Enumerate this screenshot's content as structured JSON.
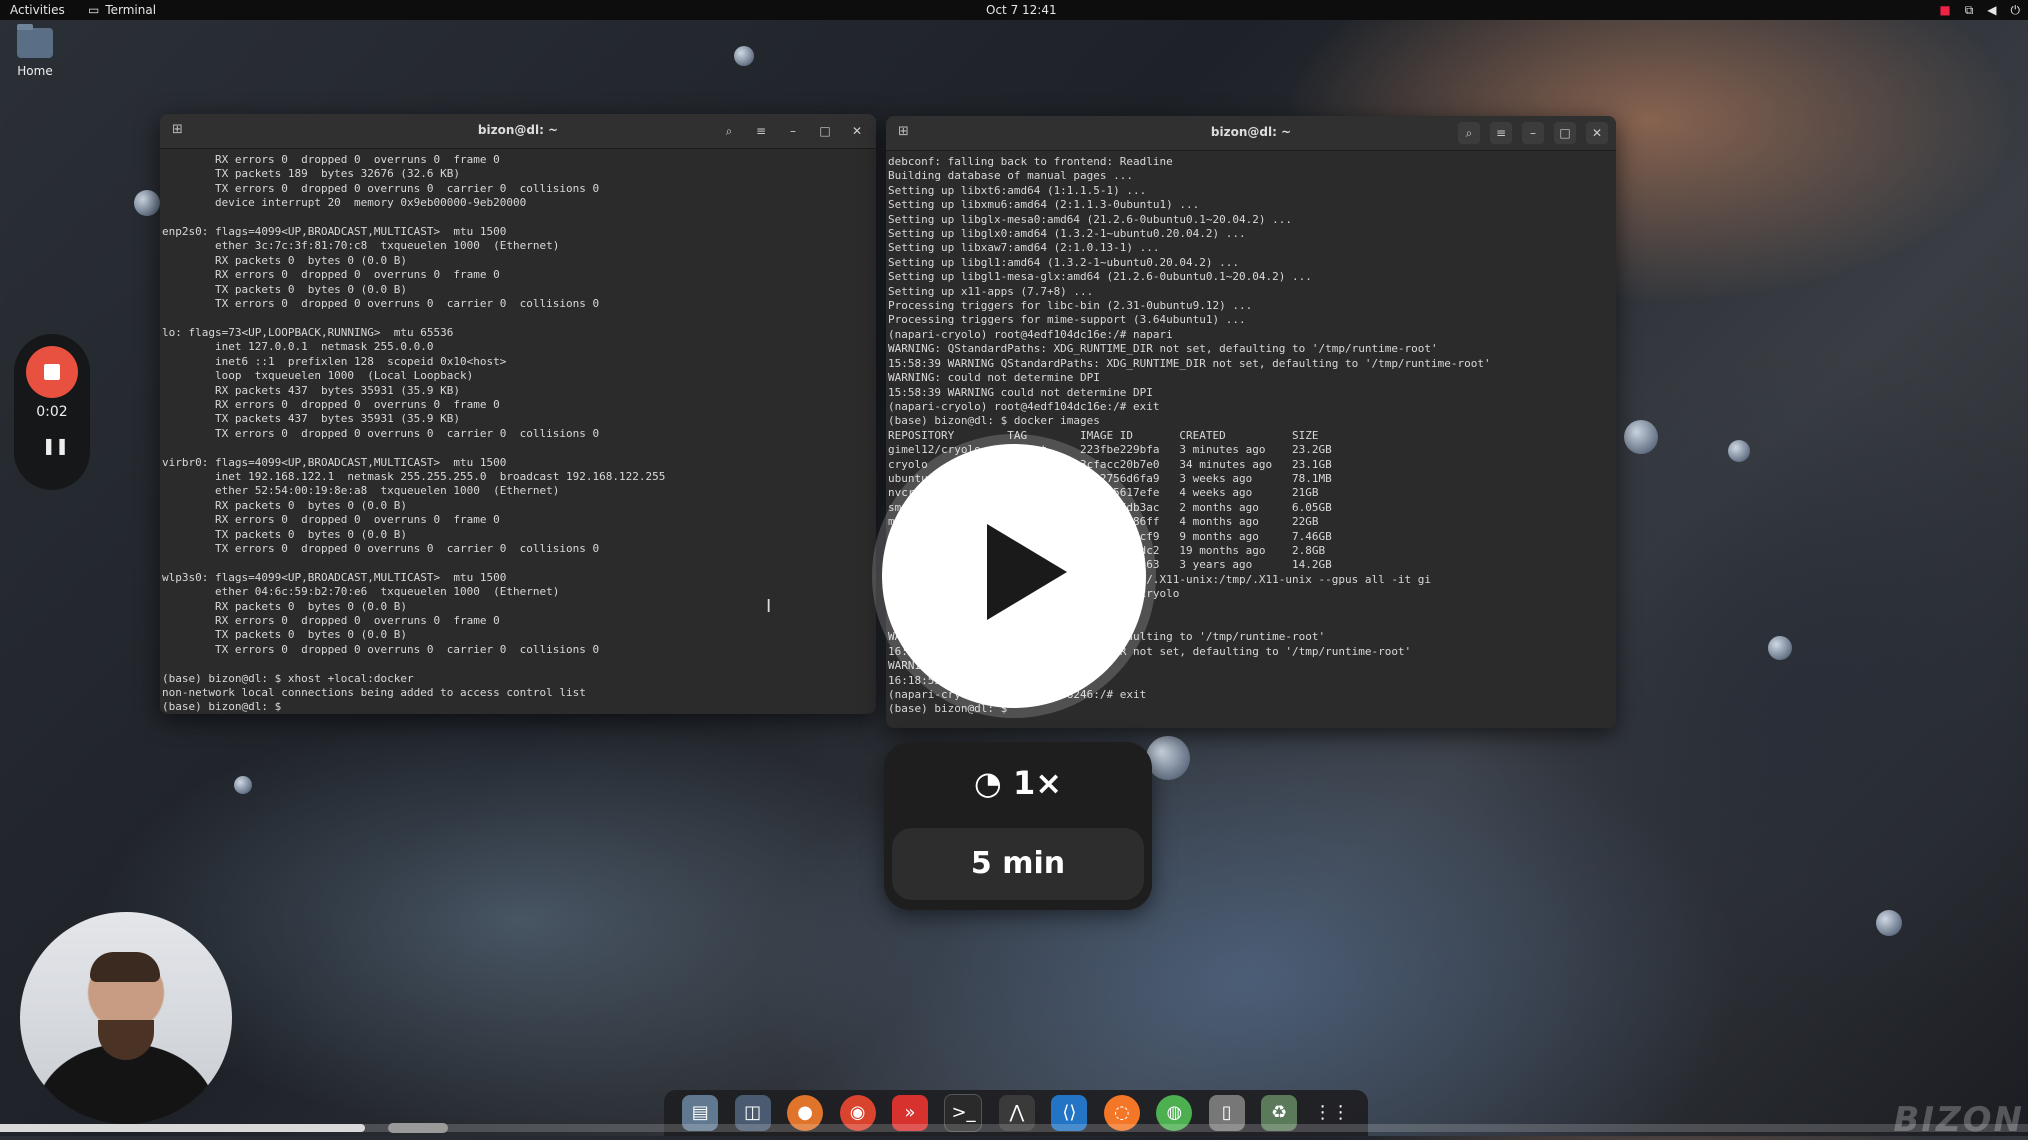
{
  "topbar": {
    "activities": "Activities",
    "app_name": "Terminal",
    "clock": "Oct 7  12:41"
  },
  "desktop": {
    "home_label": "Home"
  },
  "recorder": {
    "time": "0:02"
  },
  "terminal_left": {
    "title": "bizon@dl: ~",
    "lines": [
      "        RX errors 0  dropped 0  overruns 0  frame 0",
      "        TX packets 189  bytes 32676 (32.6 KB)",
      "        TX errors 0  dropped 0 overruns 0  carrier 0  collisions 0",
      "        device interrupt 20  memory 0x9eb00000-9eb20000",
      "",
      "enp2s0: flags=4099<UP,BROADCAST,MULTICAST>  mtu 1500",
      "        ether 3c:7c:3f:81:70:c8  txqueuelen 1000  (Ethernet)",
      "        RX packets 0  bytes 0 (0.0 B)",
      "        RX errors 0  dropped 0  overruns 0  frame 0",
      "        TX packets 0  bytes 0 (0.0 B)",
      "        TX errors 0  dropped 0 overruns 0  carrier 0  collisions 0",
      "",
      "lo: flags=73<UP,LOOPBACK,RUNNING>  mtu 65536",
      "        inet 127.0.0.1  netmask 255.0.0.0",
      "        inet6 ::1  prefixlen 128  scopeid 0x10<host>",
      "        loop  txqueuelen 1000  (Local Loopback)",
      "        RX packets 437  bytes 35931 (35.9 KB)",
      "        RX errors 0  dropped 0  overruns 0  frame 0",
      "        TX packets 437  bytes 35931 (35.9 KB)",
      "        TX errors 0  dropped 0 overruns 0  carrier 0  collisions 0",
      "",
      "virbr0: flags=4099<UP,BROADCAST,MULTICAST>  mtu 1500",
      "        inet 192.168.122.1  netmask 255.255.255.0  broadcast 192.168.122.255",
      "        ether 52:54:00:19:8e:a8  txqueuelen 1000  (Ethernet)",
      "        RX packets 0  bytes 0 (0.0 B)",
      "        RX errors 0  dropped 0  overruns 0  frame 0",
      "        TX packets 0  bytes 0 (0.0 B)",
      "        TX errors 0  dropped 0 overruns 0  carrier 0  collisions 0",
      "",
      "wlp3s0: flags=4099<UP,BROADCAST,MULTICAST>  mtu 1500",
      "        ether 04:6c:59:b2:70:e6  txqueuelen 1000  (Ethernet)",
      "        RX packets 0  bytes 0 (0.0 B)",
      "        RX errors 0  dropped 0  overruns 0  frame 0",
      "        TX packets 0  bytes 0 (0.0 B)",
      "        TX errors 0  dropped 0 overruns 0  carrier 0  collisions 0",
      "",
      "(base) bizon@dl: $ xhost +local:docker",
      "non-network local connections being added to access control list",
      "(base) bizon@dl: $ "
    ]
  },
  "terminal_right": {
    "title": "bizon@dl: ~",
    "lines": [
      "debconf: falling back to frontend: Readline",
      "Building database of manual pages ...",
      "Setting up libxt6:amd64 (1:1.1.5-1) ...",
      "Setting up libxmu6:amd64 (2:1.1.3-0ubuntu1) ...",
      "Setting up libglx-mesa0:amd64 (21.2.6-0ubuntu0.1~20.04.2) ...",
      "Setting up libglx0:amd64 (1.3.2-1~ubuntu0.20.04.2) ...",
      "Setting up libxaw7:amd64 (2:1.0.13-1) ...",
      "Setting up libgl1:amd64 (1.3.2-1~ubuntu0.20.04.2) ...",
      "Setting up libgl1-mesa-glx:amd64 (21.2.6-0ubuntu0.1~20.04.2) ...",
      "Setting up x11-apps (7.7+8) ...",
      "Processing triggers for libc-bin (2.31-0ubuntu9.12) ...",
      "Processing triggers for mime-support (3.64ubuntu1) ...",
      "(napari-cryolo) root@4edf104dc16e:/# napari",
      "WARNING: QStandardPaths: XDG_RUNTIME_DIR not set, defaulting to '/tmp/runtime-root'",
      "15:58:39 WARNING QStandardPaths: XDG_RUNTIME_DIR not set, defaulting to '/tmp/runtime-root'",
      "WARNING: could not determine DPI",
      "15:58:39 WARNING could not determine DPI",
      "(napari-cryolo) root@4edf104dc16e:/# exit",
      "(base) bizon@dl: $ docker images",
      "REPOSITORY        TAG        IMAGE ID       CREATED          SIZE",
      "gimel12/cryolo    latest     223fbe229bfa   3 minutes ago    23.2GB",
      "cryolo            latest     3cfacc20b7e0   34 minutes ago   23.1GB",
      "ubuntu                       61b2756d6fa9   3 weeks ago      78.1MB",
      "nvcr                         112a05617efe   4 weeks ago      21GB",
      "sma                          08a1b9fdb3ac   2 months ago     6.05GB",
      "my                           8470a68886ff   4 months ago     22GB",
      "                             4a5d1b78ccf9   9 months ago     7.46GB",
      "                             5711b711bdc2   19 months ago    2.8GB",
      "                             ad8f29ddeb63   3 years ago      14.2GB",
      "                  PLAY=$DISPLAY -v /tmp/.X11-unix:/tmp/.X11-unix --gpus all -it gi",
      "                       ctivate napari-cryolo",
      "",
      "                        # napari",
      "WA                 _DIR not set, defaulting to '/tmp/runtime-root'",
      "16:18                XDG_RUNTIME_DIR not set, defaulting to '/tmp/runtime-root'",
      "WARNING                 DPI",
      "16:18:53 WA      determine DPI",
      "(napari-cryolo) root@a9e90e8246:/# exit",
      "(base) bizon@dl: $ "
    ]
  },
  "player": {
    "speed": "1×",
    "duration": "5 min",
    "progress_fraction": 0.18
  },
  "watermark": "BIZON"
}
